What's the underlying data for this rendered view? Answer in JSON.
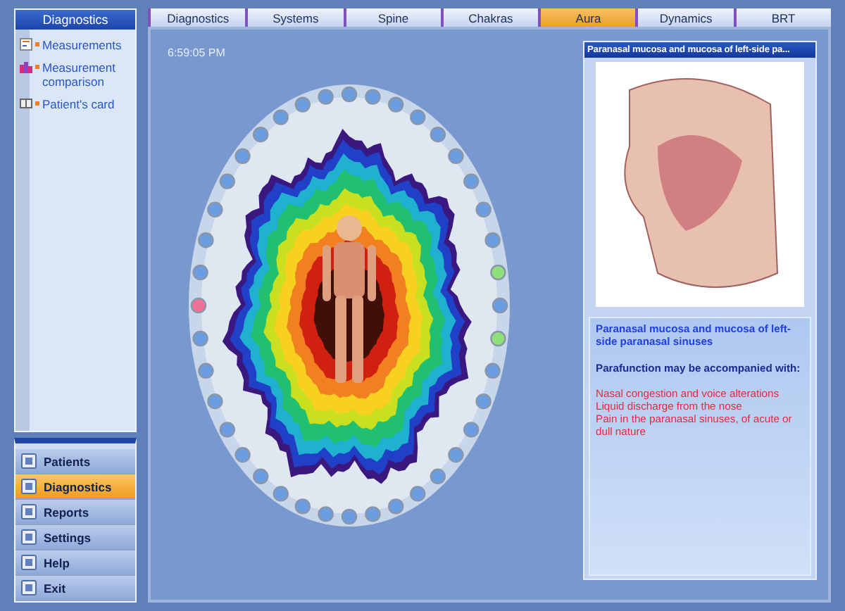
{
  "sidebar": {
    "title": "Diagnostics",
    "items": [
      {
        "label": "Measurements",
        "kind": "chart"
      },
      {
        "label": "Measurement comparison",
        "kind": "compare"
      },
      {
        "label": "Patient's card",
        "kind": "card"
      }
    ]
  },
  "nav": [
    {
      "label": "Patients",
      "selected": false
    },
    {
      "label": "Diagnostics",
      "selected": true
    },
    {
      "label": "Reports",
      "selected": false
    },
    {
      "label": "Settings",
      "selected": false
    },
    {
      "label": "Help",
      "selected": false
    },
    {
      "label": "Exit",
      "selected": false
    }
  ],
  "tabs": [
    {
      "label": "Diagnostics",
      "selected": false
    },
    {
      "label": "Systems",
      "selected": false
    },
    {
      "label": "Spine",
      "selected": false
    },
    {
      "label": "Chakras",
      "selected": false
    },
    {
      "label": "Aura",
      "selected": true
    },
    {
      "label": "Dynamics",
      "selected": false
    },
    {
      "label": "BRT",
      "selected": false
    }
  ],
  "time": "6:59:05 PM",
  "aura_points": [
    {
      "color": "#6a9ee0"
    },
    {
      "color": "#6a9ee0"
    },
    {
      "color": "#6a9ee0"
    },
    {
      "color": "#6a9ee0"
    },
    {
      "color": "#6a9ee0"
    },
    {
      "color": "#6a9ee0"
    },
    {
      "color": "#6a9ee0"
    },
    {
      "color": "#6a9ee0"
    },
    {
      "color": "#6a9ee0"
    },
    {
      "color": "#8ee07a"
    },
    {
      "color": "#6a9ee0"
    },
    {
      "color": "#8ee07a"
    },
    {
      "color": "#6a9ee0"
    },
    {
      "color": "#6a9ee0"
    },
    {
      "color": "#6a9ee0"
    },
    {
      "color": "#6a9ee0"
    },
    {
      "color": "#6a9ee0"
    },
    {
      "color": "#6a9ee0"
    },
    {
      "color": "#6a9ee0"
    },
    {
      "color": "#6a9ee0"
    },
    {
      "color": "#6a9ee0"
    },
    {
      "color": "#6a9ee0"
    },
    {
      "color": "#6a9ee0"
    },
    {
      "color": "#6a9ee0"
    },
    {
      "color": "#6a9ee0"
    },
    {
      "color": "#6a9ee0"
    },
    {
      "color": "#6a9ee0"
    },
    {
      "color": "#6a9ee0"
    },
    {
      "color": "#6a9ee0"
    },
    {
      "color": "#6a9ee0"
    },
    {
      "color": "#f07098"
    },
    {
      "color": "#6a9ee0"
    },
    {
      "color": "#6a9ee0"
    },
    {
      "color": "#6a9ee0"
    },
    {
      "color": "#6a9ee0"
    },
    {
      "color": "#6a9ee0"
    },
    {
      "color": "#6a9ee0"
    },
    {
      "color": "#6a9ee0"
    },
    {
      "color": "#6a9ee0"
    },
    {
      "color": "#6a9ee0"
    }
  ],
  "detail": {
    "header": "Paranasal mucosa and mucosa of left-side pa...",
    "title": "Paranasal mucosa and mucosa of left-side paranasal sinuses",
    "subtitle": "Parafunction may be accompanied with:",
    "symptoms": [
      "Nasal congestion and voice alterations",
      "Liquid discharge from the nose",
      "Pain in the paranasal sinuses, of acute or dull nature"
    ]
  }
}
